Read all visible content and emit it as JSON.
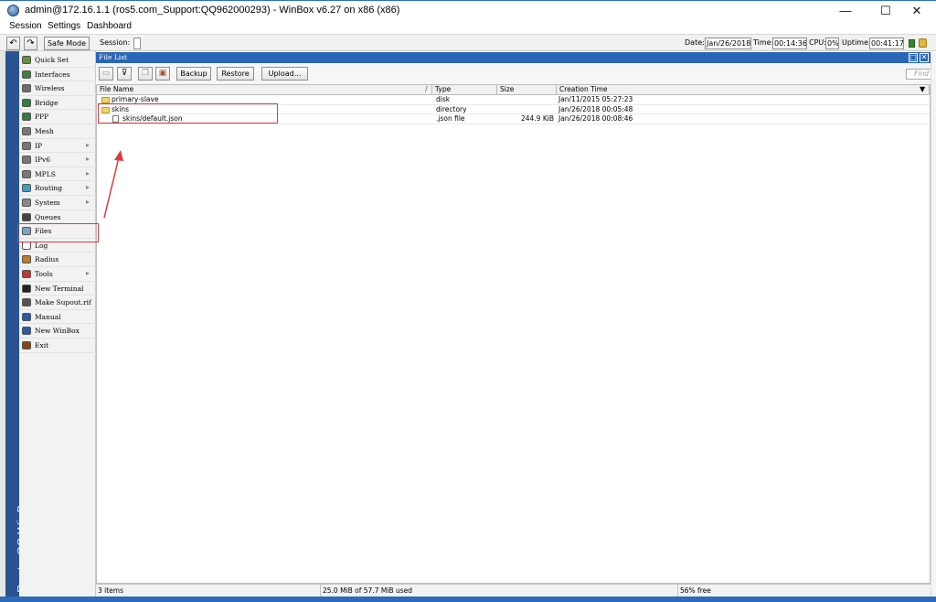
{
  "window": {
    "title": "admin@172.16.1.1 (ros5.com_Support:QQ962000293) - WinBox v6.27 on x86 (x86)",
    "minimize": "—",
    "maximize": "☐",
    "close": "✕"
  },
  "menu": [
    "Session",
    "Settings",
    "Dashboard"
  ],
  "toolbar": {
    "undo": "↶",
    "redo": "↷",
    "safe_mode": "Safe Mode",
    "session_label": "Session:",
    "date_label": "Date:",
    "date_value": "Jan/26/2018",
    "time_label": "Time:",
    "time_value": "00:14:36",
    "cpu_label": "CPU:",
    "cpu_value": "0%",
    "uptime_label": "Uptime:",
    "uptime_value": "00:41:17"
  },
  "brand_vertical": "RouterOS WinBox",
  "sidebar": {
    "items": [
      {
        "label": "Quick Set",
        "icon": "wand-icon",
        "color": "#6b8e3a",
        "submenu": false
      },
      {
        "label": "Interfaces",
        "icon": "interfaces-icon",
        "color": "#3f7f3f",
        "submenu": false
      },
      {
        "label": "Wireless",
        "icon": "wireless-icon",
        "color": "#6d6d6d",
        "submenu": false
      },
      {
        "label": "Bridge",
        "icon": "bridge-icon",
        "color": "#2f7f3f",
        "submenu": false
      },
      {
        "label": "PPP",
        "icon": "ppp-icon",
        "color": "#2f7f3f",
        "submenu": false
      },
      {
        "label": "Mesh",
        "icon": "mesh-icon",
        "color": "#777777",
        "submenu": false
      },
      {
        "label": "IP",
        "icon": "ip-icon",
        "color": "#777777",
        "submenu": true
      },
      {
        "label": "IPv6",
        "icon": "ipv6-icon",
        "color": "#777777",
        "submenu": true
      },
      {
        "label": "MPLS",
        "icon": "mpls-icon",
        "color": "#777777",
        "submenu": true
      },
      {
        "label": "Routing",
        "icon": "routing-icon",
        "color": "#3aa0c8",
        "submenu": true
      },
      {
        "label": "System",
        "icon": "system-icon",
        "color": "#888888",
        "submenu": true
      },
      {
        "label": "Queues",
        "icon": "queues-icon",
        "color": "#444444",
        "submenu": false
      },
      {
        "label": "Files",
        "icon": "files-icon",
        "color": "#7fa3c8",
        "submenu": false
      },
      {
        "label": "Log",
        "icon": "log-icon",
        "color": "#f5f5f5",
        "submenu": false
      },
      {
        "label": "Radius",
        "icon": "radius-icon",
        "color": "#c07a2a",
        "submenu": false
      },
      {
        "label": "Tools",
        "icon": "tools-icon",
        "color": "#c0392b",
        "submenu": true
      },
      {
        "label": "New Terminal",
        "icon": "terminal-icon",
        "color": "#222222",
        "submenu": false
      },
      {
        "label": "Make Supout.rif",
        "icon": "supout-icon",
        "color": "#555555",
        "submenu": false
      },
      {
        "label": "Manual",
        "icon": "manual-icon",
        "color": "#2b5aa8",
        "submenu": false
      },
      {
        "label": "New WinBox",
        "icon": "winbox-icon",
        "color": "#2b5aa8",
        "submenu": false
      },
      {
        "label": "Exit",
        "icon": "exit-icon",
        "color": "#8b4513",
        "submenu": false
      }
    ]
  },
  "file_list": {
    "title": "File List",
    "buttons": {
      "backup": "Backup",
      "restore": "Restore",
      "upload": "Upload..."
    },
    "find_placeholder": "Find",
    "columns": [
      "File Name",
      "Type",
      "Size",
      "Creation Time"
    ],
    "rows": [
      {
        "name": "primary-slave",
        "type": "disk",
        "size": "",
        "time": "Jan/11/2015 05:27:23",
        "kind": "folder",
        "indent": 0
      },
      {
        "name": "skins",
        "type": "directory",
        "size": "",
        "time": "Jan/26/2018 00:05:48",
        "kind": "folder",
        "indent": 0
      },
      {
        "name": "skins/default.json",
        "type": ".json file",
        "size": "244.9 KiB",
        "time": "Jan/26/2018 00:08:46",
        "kind": "file",
        "indent": 1
      }
    ],
    "status": {
      "count": "3 items",
      "usage": "25.0 MiB of 57.7 MiB used",
      "free": "56% free"
    }
  },
  "colors": {
    "accent": "#2a66b8",
    "brand_strip": "#2a5391",
    "annotation_red": "#e0393e"
  }
}
